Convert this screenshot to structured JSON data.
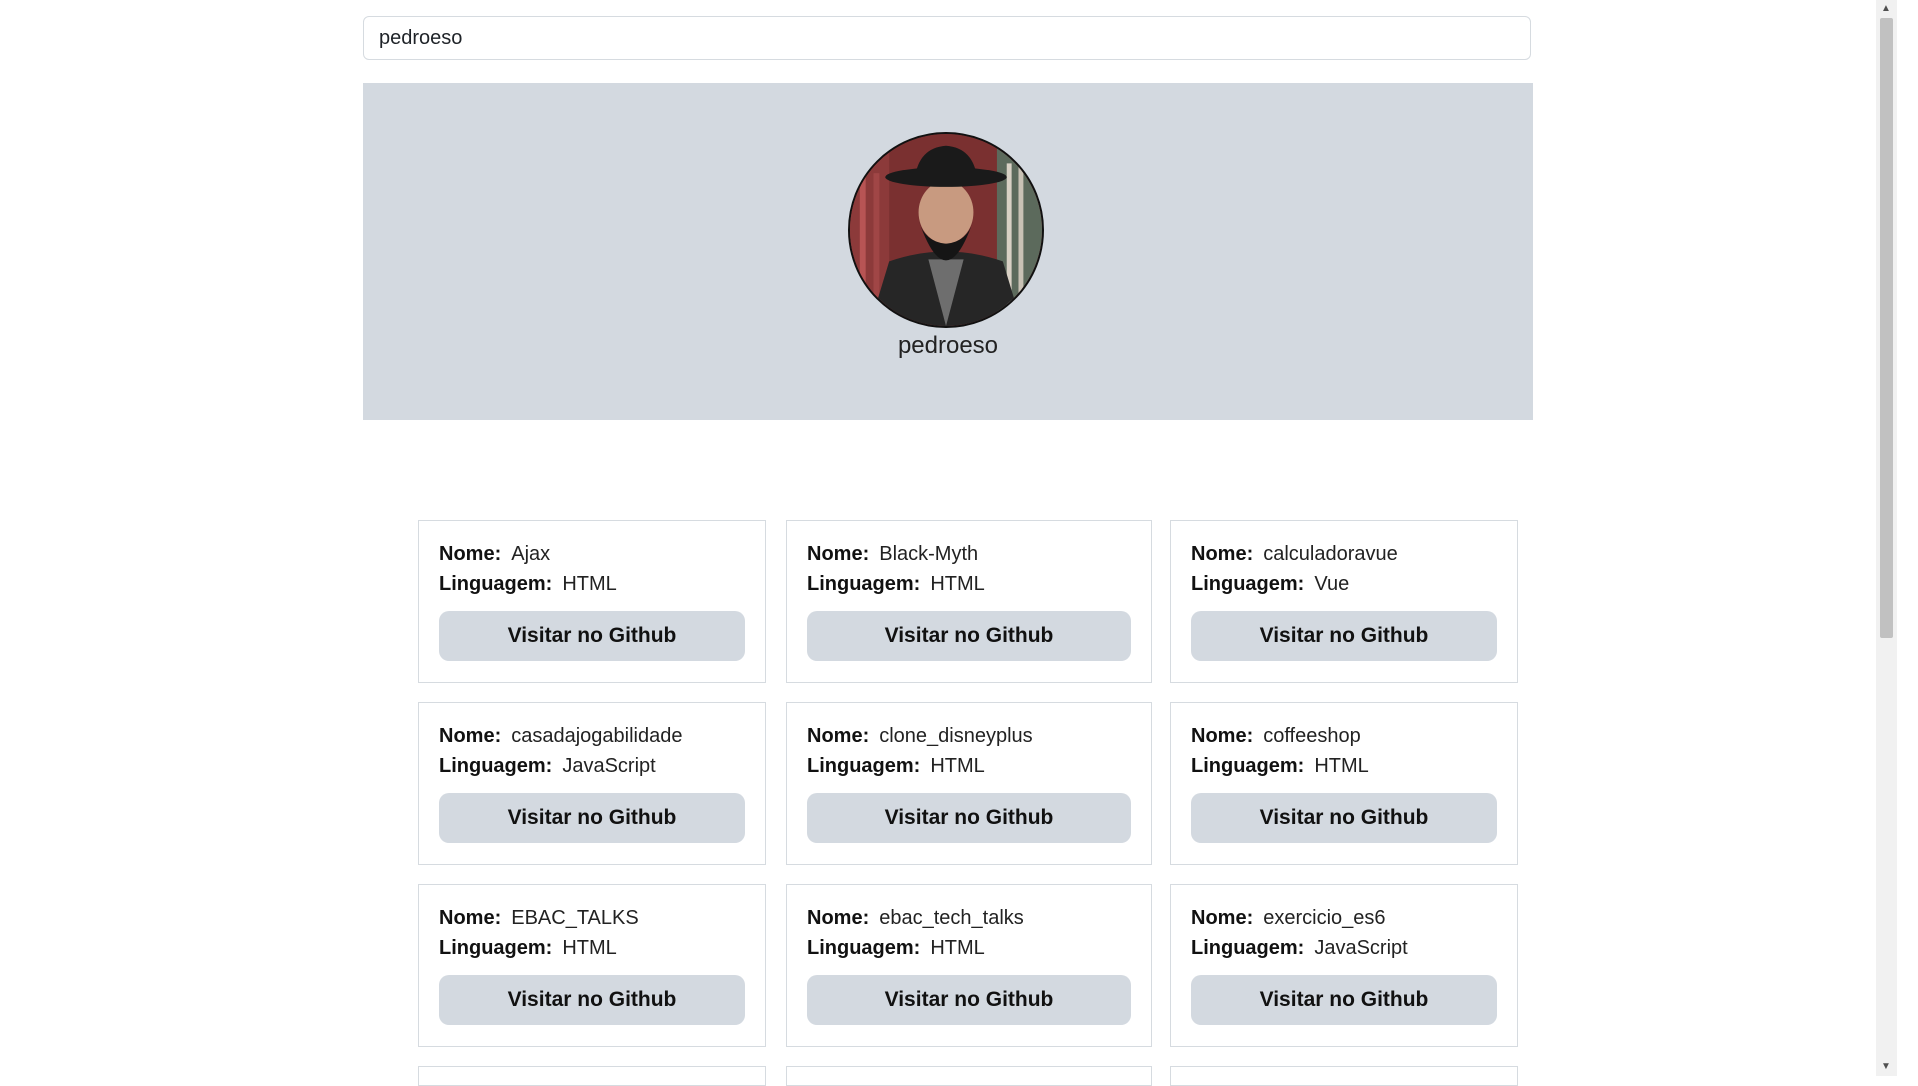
{
  "search": {
    "value": "pedroeso"
  },
  "profile": {
    "username": "pedroeso"
  },
  "labels": {
    "name": "Nome:",
    "language": "Linguagem:",
    "visit": "Visitar no Github"
  },
  "repos": [
    {
      "name": "Ajax",
      "language": "HTML"
    },
    {
      "name": "Black-Myth",
      "language": "HTML"
    },
    {
      "name": "calculadoravue",
      "language": "Vue"
    },
    {
      "name": "casadajogabilidade",
      "language": "JavaScript"
    },
    {
      "name": "clone_disneyplus",
      "language": "HTML"
    },
    {
      "name": "coffeeshop",
      "language": "HTML"
    },
    {
      "name": "EBAC_TALKS",
      "language": "HTML"
    },
    {
      "name": "ebac_tech_talks",
      "language": "HTML"
    },
    {
      "name": "exercicio_es6",
      "language": "JavaScript"
    }
  ],
  "colors": {
    "panel": "#d3d9e0",
    "button": "#d3d9e0",
    "border": "#d6dbe0"
  }
}
